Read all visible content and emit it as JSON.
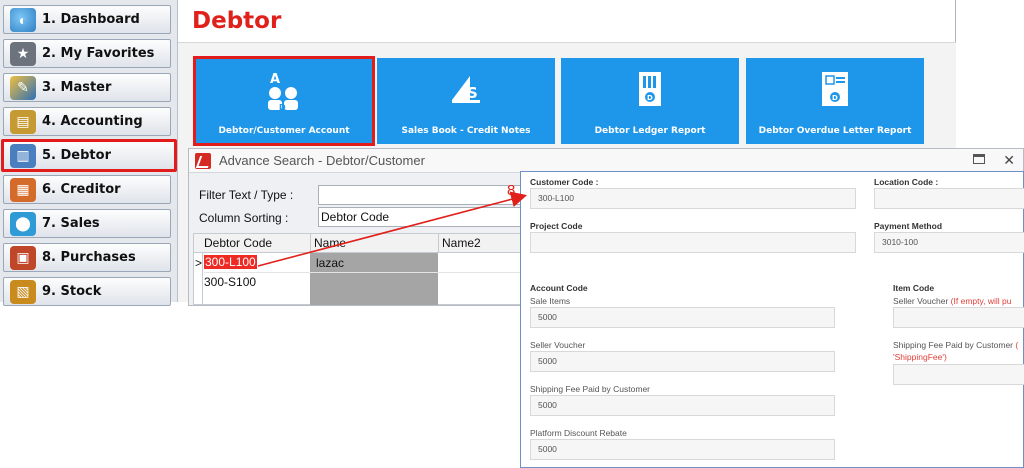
{
  "sidebar": {
    "items": [
      {
        "label": "1. Dashboard",
        "icon": "dashboard-icon",
        "color": "#3a8fd6"
      },
      {
        "label": "2. My Favorites",
        "icon": "star-folder-icon",
        "color": "#5e6670"
      },
      {
        "label": "3. Master",
        "icon": "master-icon",
        "color": "#2e6fb6"
      },
      {
        "label": "4. Accounting",
        "icon": "ledger-book-icon",
        "color": "#c59a33"
      },
      {
        "label": "5. Debtor",
        "icon": "debtor-folder-icon",
        "color": "#4a7fbf"
      },
      {
        "label": "6. Creditor",
        "icon": "creditor-icon",
        "color": "#d56b2a"
      },
      {
        "label": "7. Sales",
        "icon": "sales-icon",
        "color": "#2e9ad6"
      },
      {
        "label": "8. Purchases",
        "icon": "purchases-icon",
        "color": "#c0462a"
      },
      {
        "label": "9. Stock",
        "icon": "stock-icon",
        "color": "#c98a1e"
      }
    ],
    "active_index": 4
  },
  "main": {
    "title": "Debtor",
    "tiles": [
      {
        "label": "Debtor/Customer Account",
        "icon": "customer-account-icon"
      },
      {
        "label": "Sales Book - Credit Notes",
        "icon": "credit-note-icon"
      },
      {
        "label": "Debtor Ledger Report",
        "icon": "ledger-report-icon"
      },
      {
        "label": "Debtor Overdue Letter Report",
        "icon": "overdue-letter-icon"
      }
    ]
  },
  "advance_search": {
    "title": "Advance Search - Debtor/Customer",
    "filter_label": "Filter Text / Type :",
    "filter_value": "",
    "sort_label": "Column Sorting :",
    "sort_value": "Debtor Code",
    "columns": [
      "Debtor Code",
      "Name",
      "Name2"
    ],
    "rows": [
      {
        "marker": ">",
        "code": "300-L100",
        "name": "lazac"
      },
      {
        "marker": "",
        "code": "300-S100",
        "name": ""
      }
    ]
  },
  "step_marker": "8",
  "form": {
    "customer_code_label": "Customer Code :",
    "customer_code_value": "300-L100",
    "location_code_label": "Location Code :",
    "location_code_value": "",
    "project_code_label": "Project Code",
    "project_code_value": "",
    "payment_method_label": "Payment Method",
    "payment_method_value": "3010-100",
    "account_code_header": "Account Code",
    "item_code_header": "Item Code",
    "sale_items_label": "Sale Items",
    "sale_items_value": "5000",
    "seller_voucher_label": "Seller Voucher",
    "seller_voucher_value": "5000",
    "shipping_fee_label": "Shipping Fee Paid by Customer",
    "shipping_fee_value": "5000",
    "platform_discount_label": "Platform Discount Rebate",
    "platform_discount_value": "5000",
    "item_seller_voucher_label": "Seller Voucher",
    "item_seller_voucher_note": "(If empty, will pu",
    "item_shipping_fee_label": "Shipping Fee Paid by Customer",
    "item_shipping_fee_note_prefix": "(",
    "item_shipping_fee_note": "'ShippingFee')"
  },
  "colors": {
    "accent_red": "#e0201a",
    "tile_blue": "#1e96ea",
    "highlight_red": "#e21b1b"
  }
}
